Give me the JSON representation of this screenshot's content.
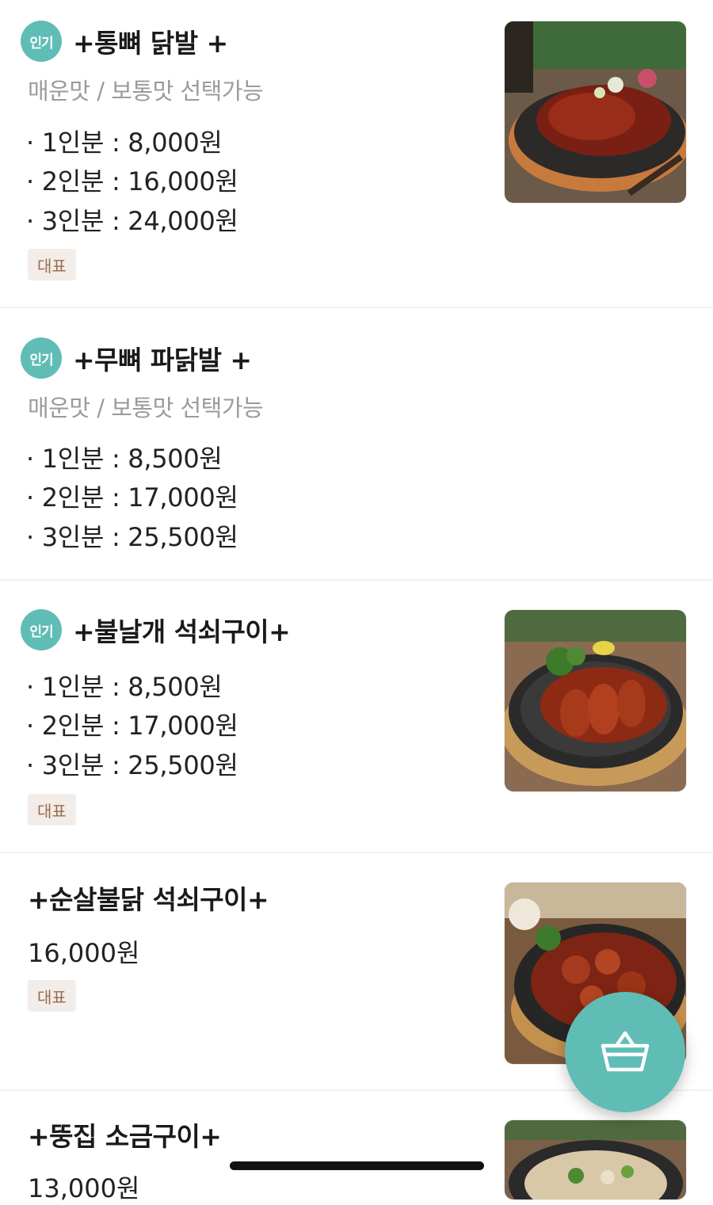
{
  "items": [
    {
      "badge": "인기",
      "title": "+통뼈 닭발 +",
      "desc": "매운맛 / 보통맛 선택가능",
      "prices": [
        "· 1인분 : 8,000원",
        "· 2인분 : 16,000원",
        "· 3인분 : 24,000원"
      ],
      "tag": "대표"
    },
    {
      "badge": "인기",
      "title": "+무뼈 파닭발 +",
      "desc": "매운맛 / 보통맛 선택가능",
      "prices": [
        "· 1인분 : 8,500원",
        "· 2인분 : 17,000원",
        "· 3인분 : 25,500원"
      ]
    },
    {
      "badge": "인기",
      "title": "+불날개 석쇠구이+",
      "prices": [
        "· 1인분 : 8,500원",
        "· 2인분 : 17,000원",
        "· 3인분 : 25,500원"
      ],
      "tag": "대표"
    },
    {
      "title": "+순살불닭 석쇠구이+",
      "price": "16,000원",
      "tag": "대표"
    },
    {
      "title": "+뚱집 소금구이+",
      "price": "13,000원"
    }
  ],
  "icons": {
    "cart": "shopping-basket-icon"
  },
  "colors": {
    "accent": "#5fbdb5",
    "tag_bg": "#f2ede8",
    "tag_text": "#9c6a4d",
    "muted": "#9b9b9b"
  }
}
